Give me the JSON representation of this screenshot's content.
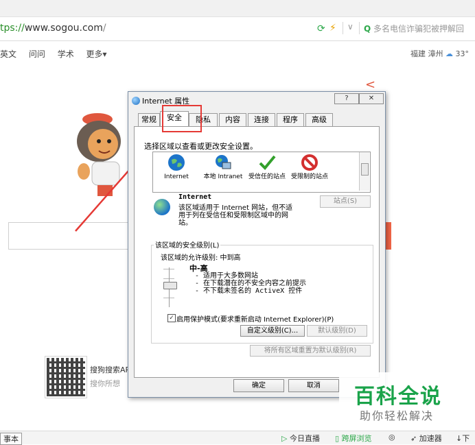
{
  "browser": {
    "url_proto": "tps://",
    "url_host": "www.sogou.com",
    "url_path": "/",
    "search_hint": "多名电信诈骗犯被押解回",
    "nav": [
      "英文",
      "问问",
      "学术",
      "更多▾"
    ],
    "weather": "福建 漳州",
    "temperature": "33°"
  },
  "promo": {
    "app_title": "搜狗搜索AP",
    "app_sub": "搜你所想"
  },
  "statusbar": {
    "left": "事本",
    "items": [
      "今日直播",
      "跨屏浏览",
      "加速器",
      "下"
    ]
  },
  "dialog": {
    "title": "Internet 属性",
    "help": "?",
    "close": "✕",
    "tabs": [
      "常规",
      "安全",
      "隐私",
      "内容",
      "连接",
      "程序",
      "高级"
    ],
    "intro": "选择区域以查看或更改安全设置。",
    "zones": [
      {
        "name": "Internet",
        "icon": "globe-icon"
      },
      {
        "name": "本地 Intranet",
        "icon": "local-intranet-icon"
      },
      {
        "name": "受信任的站点",
        "icon": "trusted-check-icon"
      },
      {
        "name": "受限制的站点",
        "icon": "restricted-icon"
      }
    ],
    "zone_title": "Internet",
    "zone_desc": "该区域适用于 Internet 网站，但不适用于列在受信任和受限制区域中的网站。",
    "sites_button": "站点(S)",
    "security_group_label": "该区域的安全级别(L)",
    "allowed_levels": "该区域的允许级别: 中到高",
    "level_name": "中-高",
    "level_lines": [
      "- 适用于大多数网站",
      "- 在下载潜在的不安全内容之前提示",
      "- 不下载未签名的 ActiveX 控件"
    ],
    "protected_mode": "启用保护模式(要求重新启动 Internet Explorer)(P)",
    "protected_mode_checked": true,
    "custom_level_button": "自定义级别(C)...",
    "default_level_button": "默认级别(D)",
    "reset_all_button": "将所有区域重置为默认级别(R)",
    "ok_button": "确定",
    "cancel_button": "取消"
  },
  "watermark": {
    "title": "百科全说",
    "sub": "助你轻松解决"
  },
  "colors": {
    "highlight_red": "#e53935",
    "watermark_green": "#1aa34a",
    "sogou_orange": "#f06446"
  }
}
